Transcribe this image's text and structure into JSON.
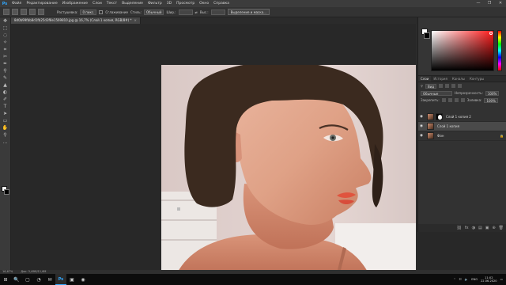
{
  "app": {
    "logo": "Ps",
    "menu": [
      "Файл",
      "Редактирование",
      "Изображение",
      "Слои",
      "Текст",
      "Выделение",
      "Фильтр",
      "3D",
      "Просмотр",
      "Окно",
      "Справка"
    ],
    "window_controls": [
      "—",
      "❐",
      "✕"
    ]
  },
  "options": {
    "feather_label": "Растушевка:",
    "feather_value": "0 пикс.",
    "antialias_label": "Сглаживание",
    "style_label": "Стиль:",
    "style_value": "Обычный",
    "width_label": "Шир.:",
    "height_label": "Выс.:",
    "select_mask_button": "Выделение и маска..."
  },
  "document": {
    "tab_title": "8d0b99fbb8d1fb25d3f8e1569810.jpg @ 16,7% (Слой 1 копия, RGB/8#) *",
    "tab_close": "×"
  },
  "tools": [
    "✥",
    "⬚",
    "◌",
    "✧",
    "⌗",
    "✂",
    "✒",
    "⚲",
    "✎",
    "▲",
    "◐",
    "✐",
    "T",
    "➤",
    "▭",
    "✋",
    "⚲",
    "…"
  ],
  "layers_panel": {
    "tabs": [
      "Слои",
      "История",
      "Каналы",
      "Контуры"
    ],
    "active_tab": 0,
    "filter_label": "Вид",
    "blend_mode": "Обычные",
    "opacity_label": "Непрозрачность:",
    "opacity_value": "100%",
    "lock_label": "Закрепить:",
    "fill_label": "Заливка:",
    "fill_value": "100%",
    "layers": [
      {
        "name": "Слой 1 копия 2",
        "visible": true,
        "has_mask": true,
        "active": false
      },
      {
        "name": "Слой 1 копия",
        "visible": true,
        "has_mask": false,
        "active": true
      },
      {
        "name": "Фон",
        "visible": true,
        "has_mask": false,
        "active": false
      }
    ],
    "bottom_icons": [
      "fx",
      "◑",
      "▤",
      "▣",
      "⊕",
      "🗑"
    ]
  },
  "status": {
    "zoom": "16,67%",
    "doc_size": "Док: 3,49M/11,6M"
  },
  "taskbar": {
    "start_icon": "⊞",
    "apps": [
      "🔍",
      "▢",
      "◔",
      "✉",
      "Ps",
      "▣",
      "◉"
    ],
    "active_app_index": 4,
    "language": "ENG",
    "time": "11:02",
    "date": "22.06.2020"
  },
  "colors": {
    "accent": "#31a8ff",
    "fg_color": "#ffffff",
    "bg_color": "#000000"
  }
}
